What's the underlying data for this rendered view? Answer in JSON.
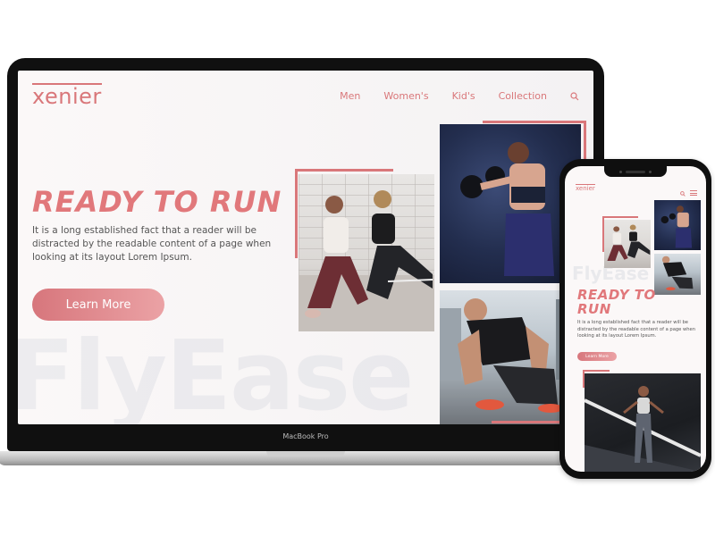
{
  "laptop": {
    "model_label": "MacBook Pro",
    "site": {
      "brand": "xenier",
      "nav": [
        "Men",
        "Women's",
        "Kid's",
        "Collection"
      ],
      "hero_title": "READY TO RUN",
      "hero_text": "It is a long established fact that a reader will be distracted by the readable content of a page when looking at its layout Lorem Ipsum.",
      "cta_label": "Learn More",
      "watermark": "FlyEase"
    }
  },
  "phone": {
    "brand": "xenier",
    "hero_title": "READY TO RUN",
    "hero_text": "It is a long established fact that a reader will be distracted by the readable content of a page when looking at its layout Lorem Ipsum.",
    "cta_label": "Learn More",
    "watermark": "FlyEase"
  },
  "colors": {
    "accent": "#d9777a",
    "title": "#e1787b",
    "body_text": "#555555",
    "device": "#101010"
  },
  "icons": {
    "search": "search-icon",
    "menu": "hamburger-menu-icon"
  }
}
